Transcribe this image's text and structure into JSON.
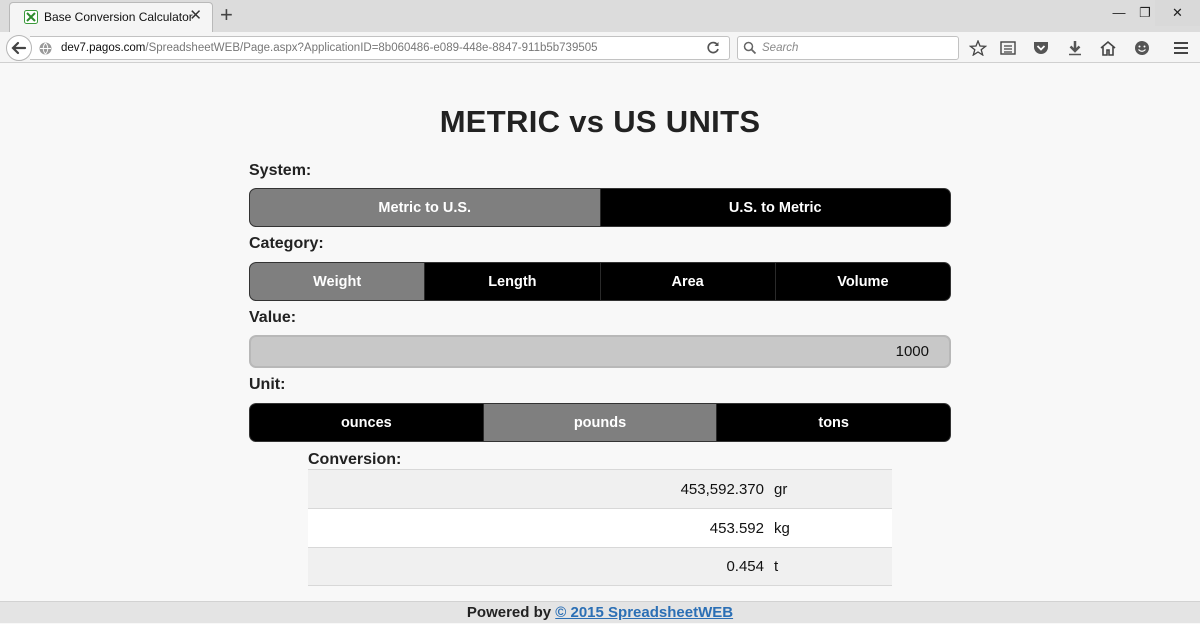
{
  "browser": {
    "tab_title": "Base Conversion Calculator",
    "new_tab_label": "+",
    "url_host": "dev7.pagos.com",
    "url_path": "/SpreadsheetWEB/Page.aspx?ApplicationID=8b060486-e089-448e-8847-911b5b739505",
    "search_placeholder": "Search"
  },
  "page": {
    "title": "METRIC vs US UNITS",
    "system_label": "System:",
    "system_options": [
      {
        "label": "Metric to U.S.",
        "active": true
      },
      {
        "label": "U.S. to Metric",
        "active": false
      }
    ],
    "category_label": "Category:",
    "category_options": [
      {
        "label": "Weight",
        "active": true
      },
      {
        "label": "Length",
        "active": false
      },
      {
        "label": "Area",
        "active": false
      },
      {
        "label": "Volume",
        "active": false
      }
    ],
    "value_label": "Value:",
    "value": "1000",
    "unit_label": "Unit:",
    "unit_options": [
      {
        "label": "ounces",
        "active": false
      },
      {
        "label": "pounds",
        "active": true
      },
      {
        "label": "tons",
        "active": false
      }
    ],
    "conversion_label": "Conversion:",
    "conversions": [
      {
        "value": "453,592.370",
        "unit": "gr"
      },
      {
        "value": "453.592",
        "unit": "kg"
      },
      {
        "value": "0.454",
        "unit": "t"
      }
    ]
  },
  "footer": {
    "prefix": "Powered by",
    "link": "© 2015 SpreadsheetWEB"
  },
  "colors": {
    "active_segment": "#7f7f7f",
    "inactive_segment": "#000000",
    "footer_link": "#2b6fb5"
  }
}
